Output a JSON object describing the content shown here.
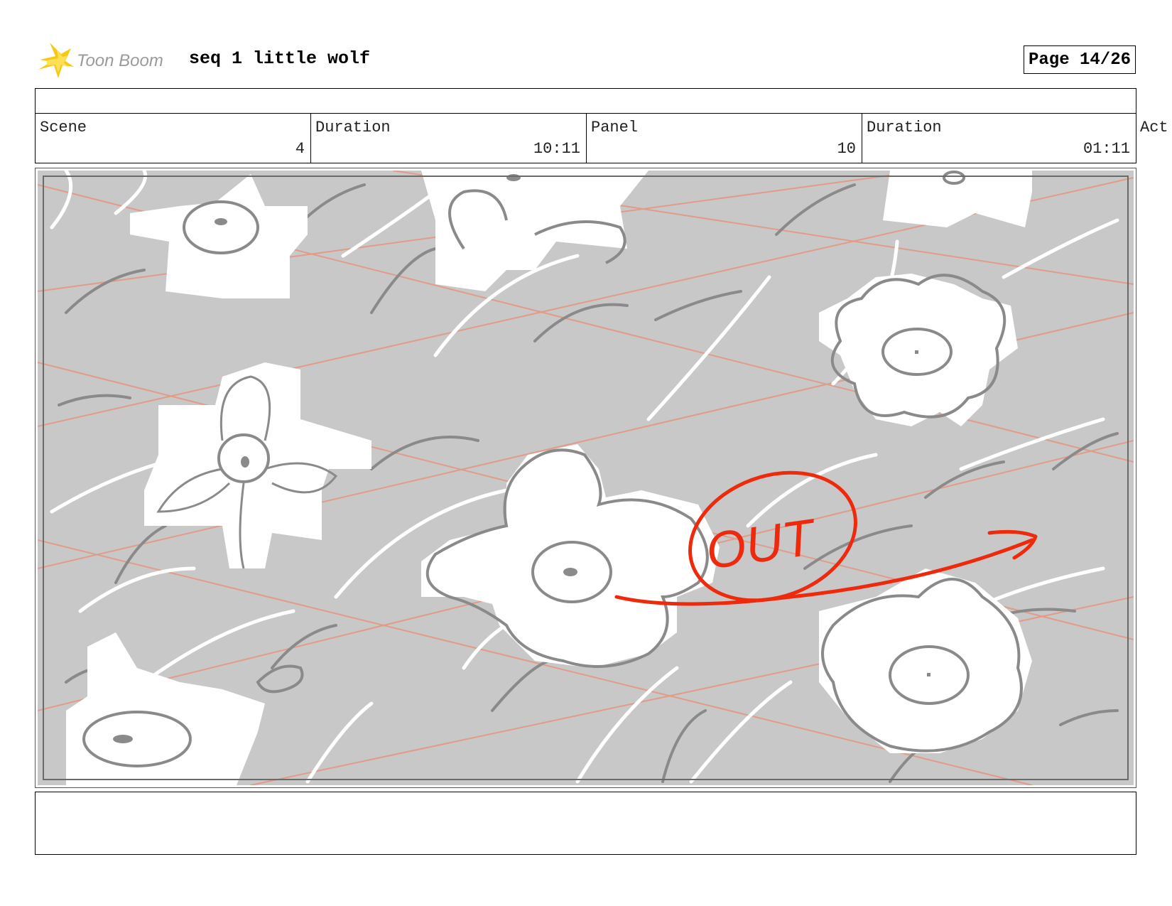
{
  "header": {
    "brand": "Toon Boom",
    "title": "seq 1 little wolf",
    "page": "Page 14/26"
  },
  "info": {
    "scene_label": "Scene",
    "scene_value": "4",
    "scene_duration_label": "Duration",
    "scene_duration_value": "10:11",
    "panel_label": "Panel",
    "panel_value": "10",
    "panel_duration_label": "Duration",
    "panel_duration_value": "01:11",
    "action_label": "Act"
  },
  "sketch": {
    "annotation_text": "OUT",
    "background_color": "#c8c8c8",
    "annotation_color": "#ef2a0c",
    "guide_line_color": "#e8907a"
  },
  "colors": {
    "logo_star": "#f6c913",
    "logo_text": "#9a9a9a"
  }
}
